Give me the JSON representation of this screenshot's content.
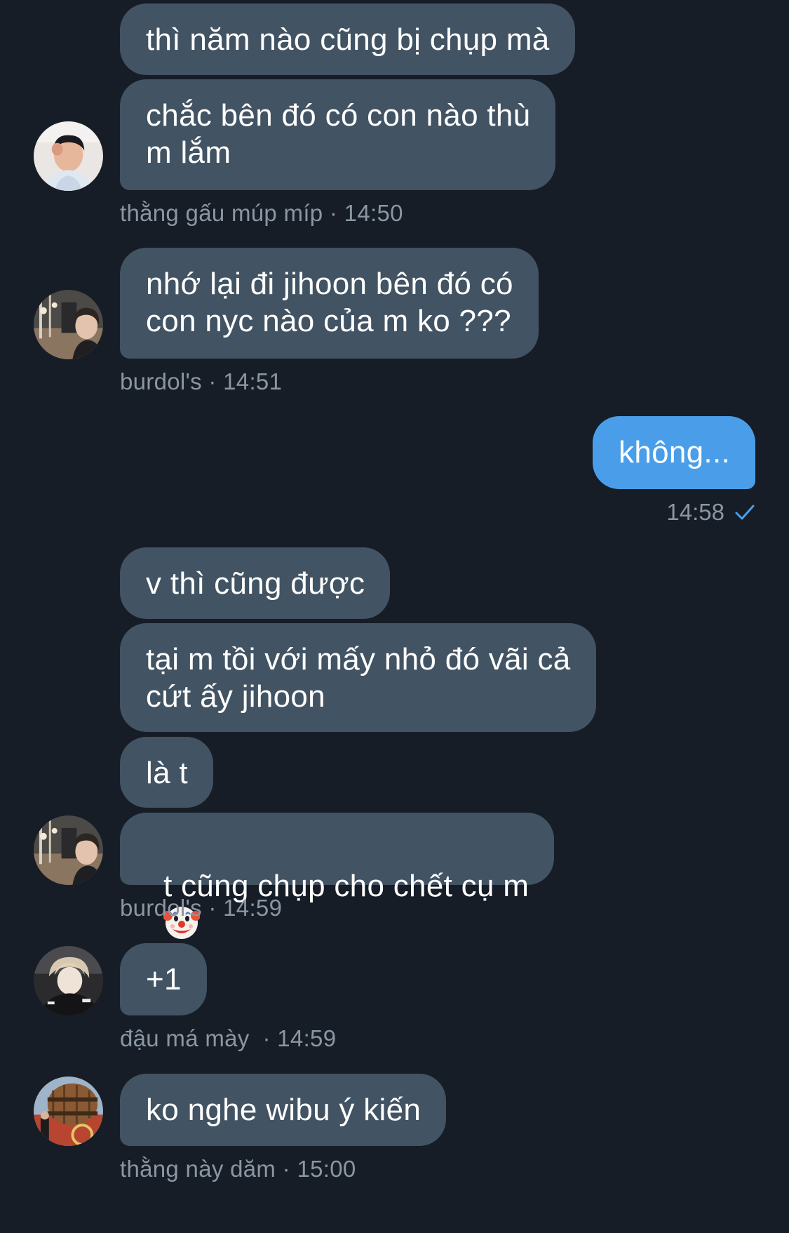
{
  "theme": {
    "background": "#161d27",
    "bubble_in": "#425363",
    "bubble_out": "#4a9ee9",
    "meta_text": "#8b96a3",
    "read_check": "#4a9ee9"
  },
  "messages": [
    {
      "text": "thì năm nào cũng bị chụp mà"
    },
    {
      "text": "chắc bên đó có con nào thù\nm lắm"
    },
    {
      "text": "nhớ lại đi jihoon bên đó có\ncon nyc nào của m ko ???"
    },
    {
      "text": "không..."
    },
    {
      "text": "v thì cũng được"
    },
    {
      "text": "tại m tồi với mấy nhỏ đó vãi cả\ncứt ấy jihoon"
    },
    {
      "text": "là t"
    },
    {
      "text": "t cũng chụp cho chết cụ m",
      "emoji": "clown-face-emoji"
    },
    {
      "text": "+1"
    },
    {
      "text": "ko nghe wibu ý kiến"
    }
  ],
  "meta": [
    {
      "text": "thằng gấu múp míp · 14:50"
    },
    {
      "text": "burdol's · 14:51"
    },
    {
      "text": "14:58",
      "icon": "read-check-icon"
    },
    {
      "text": "burdol's · 14:59"
    },
    {
      "text": "đậu má mày  · 14:59"
    },
    {
      "text": "thằng này dăm · 15:00"
    }
  ],
  "avatars": [
    {
      "icon": "avatar-thang-gau-mup-mip"
    },
    {
      "icon": "avatar-burdols"
    },
    {
      "icon": "avatar-burdols"
    },
    {
      "icon": "avatar-dau-ma-may"
    },
    {
      "icon": "avatar-thang-nay-dam"
    }
  ]
}
